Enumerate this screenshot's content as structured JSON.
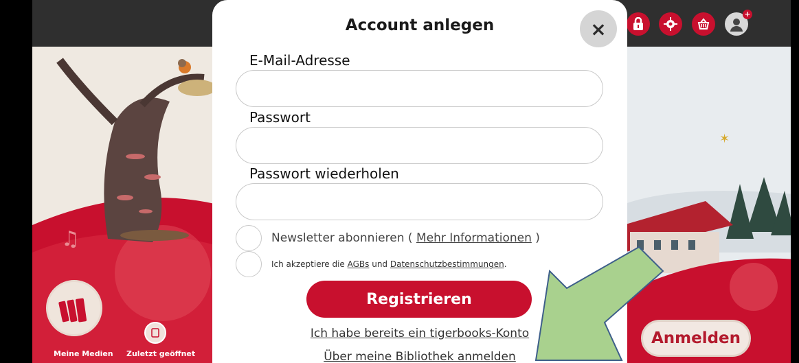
{
  "modal": {
    "title": "Account anlegen",
    "close_glyph": "×",
    "email_label": "E-Mail-Adresse",
    "email_value": "",
    "password_label": "Passwort",
    "password_value": "",
    "password_repeat_label": "Passwort wiederholen",
    "password_repeat_value": "",
    "newsletter_text": "Newsletter abonnieren (",
    "newsletter_link": "Mehr Informationen",
    "newsletter_close": ")",
    "terms_prefix": "Ich akzeptiere die",
    "terms_link_agb": "AGBs",
    "terms_and": "und",
    "terms_link_privacy": "Datenschutzbestimmungen",
    "terms_suffix": ".",
    "register_label": "Registrieren",
    "existing_account_link": "Ich habe bereits ein tigerbooks-Konto",
    "library_login_link": "Über meine Bibliothek anmelden"
  },
  "topbar": {
    "icons": [
      "lock-icon",
      "gear-icon",
      "basket-icon",
      "user-icon"
    ]
  },
  "bottom_nav": {
    "my_media_label": "Meine Medien",
    "recent_label": "Zuletzt geöffnet"
  },
  "login_button_label": "Anmelden",
  "colors": {
    "brand_red": "#c8102e",
    "arrow_green": "#a9d18e",
    "arrow_stroke": "#3e5f8a"
  }
}
